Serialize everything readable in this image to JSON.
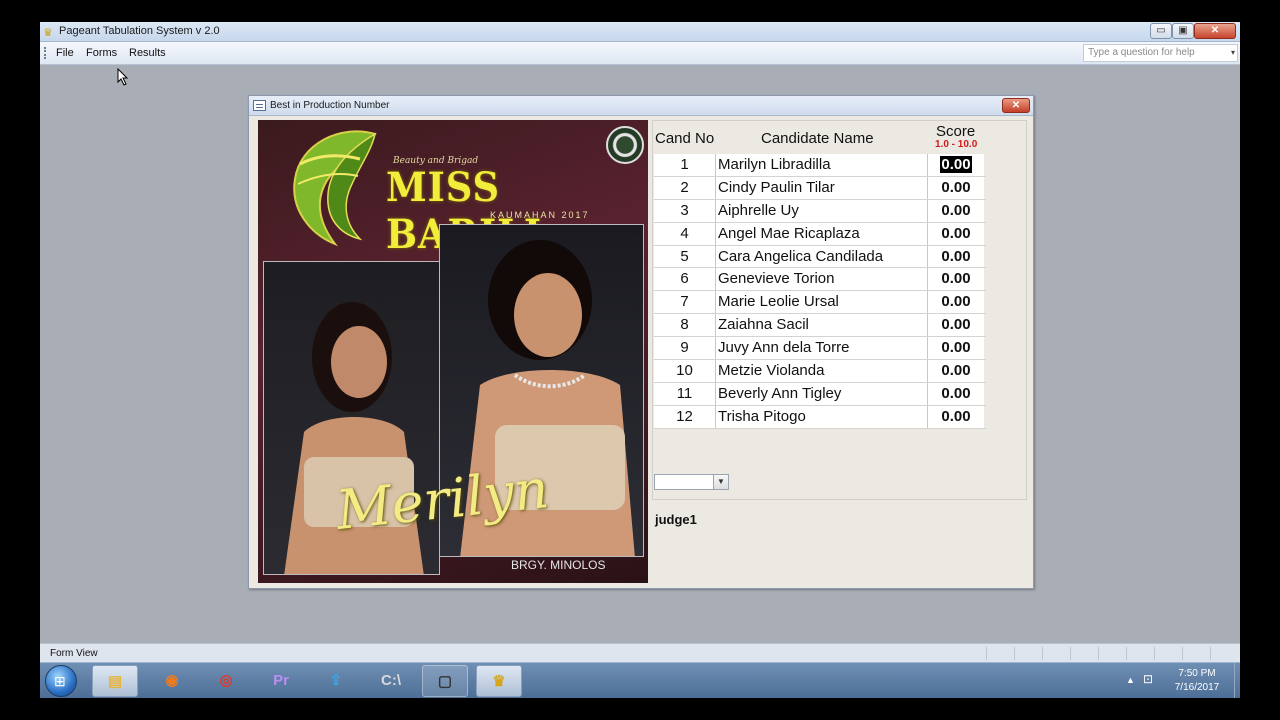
{
  "window": {
    "title": "Pageant Tabulation System v 2.0",
    "minimize_glyph": "▭",
    "maximize_glyph": "▣",
    "close_glyph": "✕"
  },
  "menu": {
    "items": [
      {
        "label": "File"
      },
      {
        "label": "Forms"
      },
      {
        "label": "Results"
      }
    ],
    "help_placeholder": "Type a question for help"
  },
  "form": {
    "title": "Best in Production Number",
    "close_glyph": "✕",
    "photo": {
      "brand_small": "Beauty and Brigad",
      "brand": "MISS BARILI",
      "brand_sub": "KAUMAHAN 2017",
      "script_name": "Merilyn",
      "caption": "BRGY. MINOLOS"
    },
    "table": {
      "header_no": "Cand No",
      "header_name": "Candidate Name",
      "header_score": "Score",
      "score_range": "1.0 - 10.0",
      "rows": [
        {
          "no": "1",
          "name": "Marilyn Libradilla",
          "score": "0.00"
        },
        {
          "no": "2",
          "name": "Cindy Paulin Tilar",
          "score": "0.00"
        },
        {
          "no": "3",
          "name": "Aiphrelle Uy",
          "score": "0.00"
        },
        {
          "no": "4",
          "name": "Angel Mae Ricaplaza",
          "score": "0.00"
        },
        {
          "no": "5",
          "name": "Cara Angelica Candilada",
          "score": "0.00"
        },
        {
          "no": "6",
          "name": "Genevieve Torion",
          "score": "0.00"
        },
        {
          "no": "7",
          "name": "Marie Leolie Ursal",
          "score": "0.00"
        },
        {
          "no": "8",
          "name": "Zaiahna Sacil",
          "score": "0.00"
        },
        {
          "no": "9",
          "name": "Juvy Ann dela Torre",
          "score": "0.00"
        },
        {
          "no": "10",
          "name": "Metzie Violanda",
          "score": "0.00"
        },
        {
          "no": "11",
          "name": "Beverly Ann Tigley",
          "score": "0.00"
        },
        {
          "no": "12",
          "name": "Trisha Pitogo",
          "score": "0.00"
        }
      ]
    },
    "combo_value": "",
    "judge": "judge1"
  },
  "statusbar": {
    "text": "Form View"
  },
  "taskbar": {
    "items": [
      {
        "name": "file-explorer",
        "glyph": "▤",
        "color": "#e8b33a"
      },
      {
        "name": "firefox",
        "glyph": "◉",
        "color": "#f07b1c"
      },
      {
        "name": "chrome",
        "glyph": "◎",
        "color": "#dd3a2c"
      },
      {
        "name": "premiere",
        "glyph": "Pr",
        "color": "#b98ef0"
      },
      {
        "name": "cloud-upload",
        "glyph": "⇪",
        "color": "#3aa5e6"
      },
      {
        "name": "command-prompt",
        "glyph": "C:\\",
        "color": "#d8d8d8"
      },
      {
        "name": "window-app",
        "glyph": "▢",
        "color": "#333"
      },
      {
        "name": "pageant-crown",
        "glyph": "♛",
        "color": "#d6a51c"
      }
    ],
    "time": "7:50 PM",
    "date": "7/16/2017"
  },
  "colors": {
    "desktop": "#a9adb6",
    "score_range": "#d01a1a",
    "brand": "#f2ec3a"
  }
}
